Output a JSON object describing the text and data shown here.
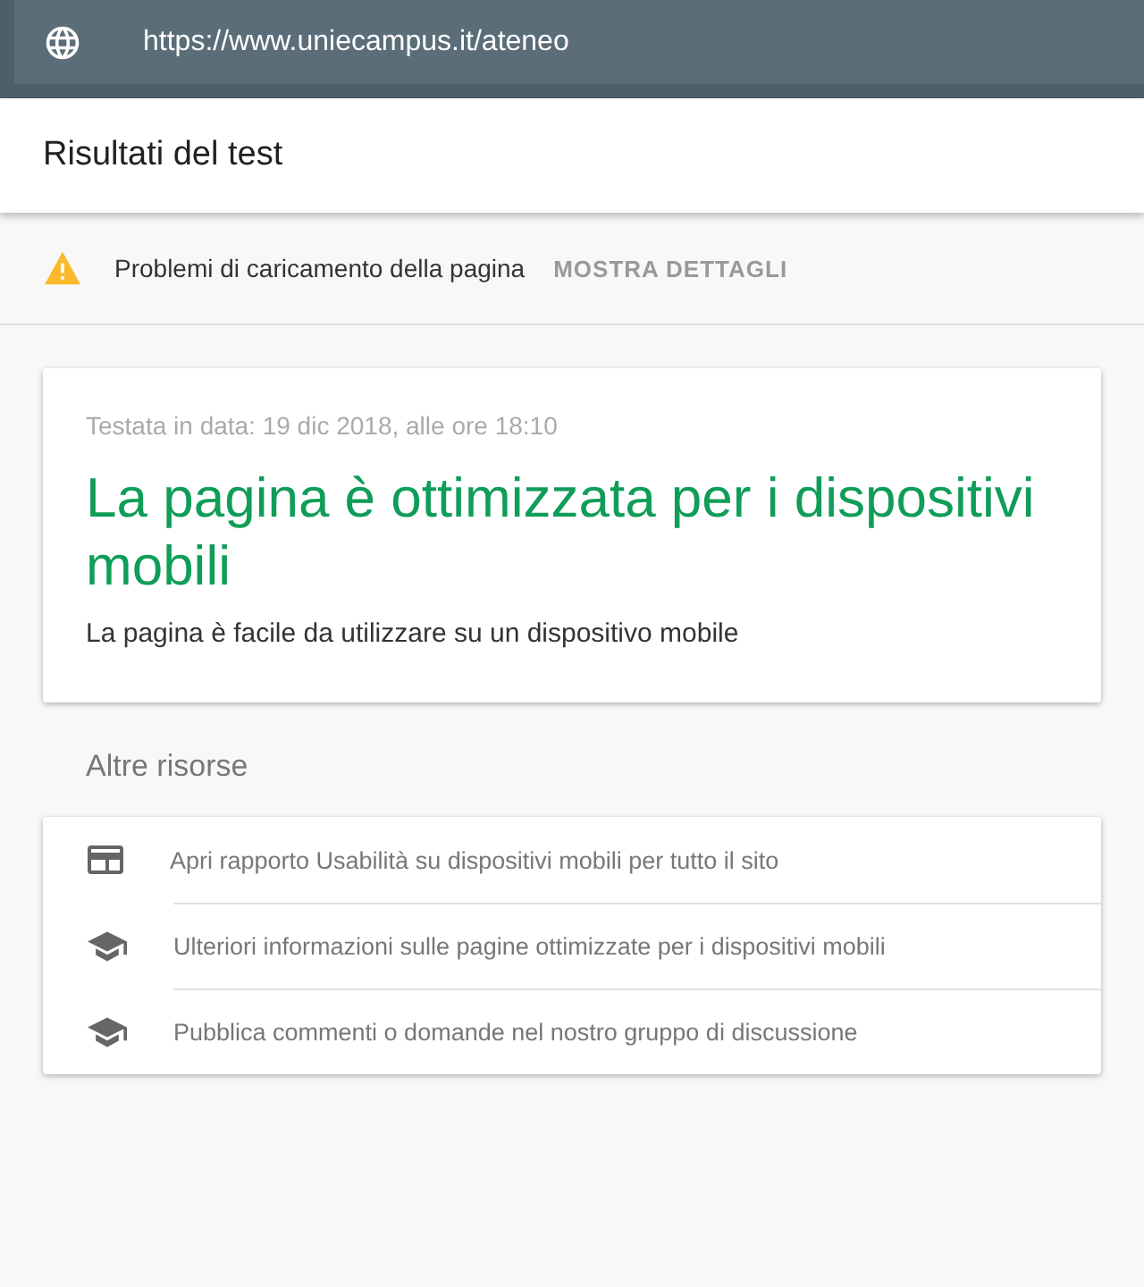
{
  "url_bar": {
    "url": "https://www.uniecampus.it/ateneo"
  },
  "header": {
    "title": "Risultati del test"
  },
  "warning": {
    "message": "Problemi di caricamento della pagina",
    "action": "MOSTRA DETTAGLI"
  },
  "result": {
    "tested": "Testata in data: 19 dic 2018, alle ore 18:10",
    "headline": "La pagina è ottimizzata per i dispositivi mobili",
    "description": "La pagina è facile da utilizzare su un dispositivo mobile"
  },
  "resources": {
    "title": "Altre risorse",
    "items": [
      {
        "kind": "report",
        "label": "Apri rapporto Usabilità su dispositivi mobili per tutto il sito"
      },
      {
        "kind": "learn",
        "label": "Ulteriori informazioni sulle pagine ottimizzate per i dispositivi mobili"
      },
      {
        "kind": "learn",
        "label": "Pubblica commenti o domande nel nostro gruppo di discussione"
      }
    ]
  }
}
